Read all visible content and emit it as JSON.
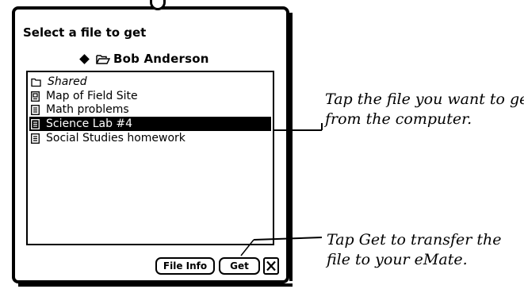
{
  "dialog": {
    "title": "Select a file to get",
    "folder_name": "Bob Anderson"
  },
  "file_list": {
    "items": [
      {
        "label": "Shared",
        "icon": "folder-icon",
        "selected": false,
        "italic": true
      },
      {
        "label": "Map of Field Site",
        "icon": "document-icon",
        "selected": false,
        "italic": false
      },
      {
        "label": "Math problems",
        "icon": "document-icon",
        "selected": false,
        "italic": false
      },
      {
        "label": "Science Lab #4",
        "icon": "document-icon",
        "selected": true,
        "italic": false
      },
      {
        "label": "Social Studies homework",
        "icon": "document-icon",
        "selected": false,
        "italic": false
      }
    ]
  },
  "buttons": {
    "file_info": "File Info",
    "get": "Get"
  },
  "annotations": {
    "tap_file_line1": "Tap the file you want to get",
    "tap_file_line2": "from the computer.",
    "tap_get_line1": "Tap Get to transfer the",
    "tap_get_line2": "file to your eMate."
  }
}
